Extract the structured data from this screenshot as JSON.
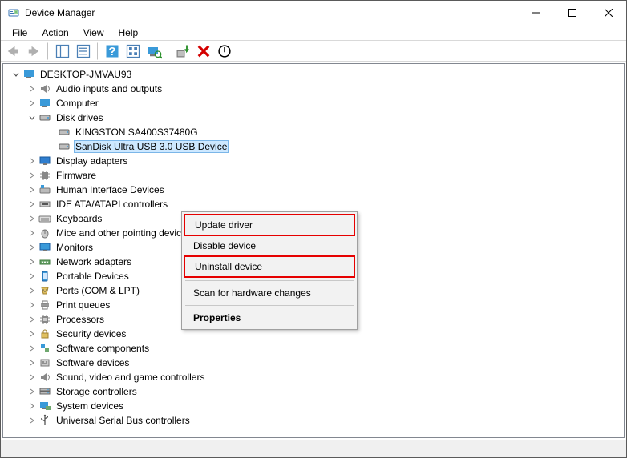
{
  "title": "Device Manager",
  "menubar": [
    "File",
    "Action",
    "View",
    "Help"
  ],
  "tree": {
    "root": "DESKTOP-JMVAU93",
    "disk_drives_label": "Disk drives",
    "disk_drives": [
      "KINGSTON SA400S37480G",
      "SanDisk Ultra USB 3.0 USB Device"
    ],
    "categories": [
      "Audio inputs and outputs",
      "Computer",
      "Display adapters",
      "Firmware",
      "Human Interface Devices",
      "IDE ATA/ATAPI controllers",
      "Keyboards",
      "Mice and other pointing devices",
      "Monitors",
      "Network adapters",
      "Portable Devices",
      "Ports (COM & LPT)",
      "Print queues",
      "Processors",
      "Security devices",
      "Software components",
      "Software devices",
      "Sound, video and game controllers",
      "Storage controllers",
      "System devices",
      "Universal Serial Bus controllers"
    ]
  },
  "context_menu": {
    "update": "Update driver",
    "disable": "Disable device",
    "uninstall": "Uninstall device",
    "scan": "Scan for hardware changes",
    "properties": "Properties"
  }
}
